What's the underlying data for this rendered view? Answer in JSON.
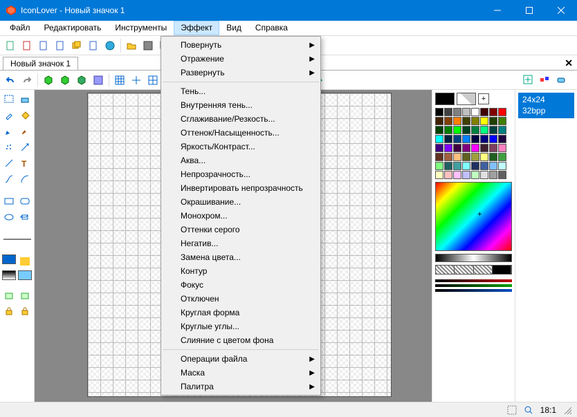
{
  "window": {
    "title": "IconLover - Новый значок 1"
  },
  "menubar": {
    "file": "Файл",
    "edit": "Редактировать",
    "tools": "Инструменты",
    "effect": "Эффект",
    "view": "Вид",
    "help": "Справка"
  },
  "tab": {
    "name": "Новый значок 1"
  },
  "dropdown": {
    "rotate": "Повернуть",
    "flip": "Отражение",
    "unfold": "Развернуть",
    "shadow": "Тень...",
    "inner_shadow": "Внутренняя тень...",
    "smooth": "Сглаживание/Резкость...",
    "hue": "Оттенок/Насыщенность...",
    "brightness": "Яркость/Контраст...",
    "aqua": "Аква...",
    "opacity": "Непрозрачность...",
    "invert_opacity": "Инвертировать непрозрачность",
    "colorize": "Окрашивание...",
    "mono": "Монохром...",
    "grayscale": "Оттенки серого",
    "negative": "Негатив...",
    "replace_color": "Замена цвета...",
    "outline": "Контур",
    "focus": "Фокус",
    "disabled": "Отключен",
    "round_shape": "Круглая форма",
    "round_corners": "Круглые углы...",
    "merge_bg": "Слияние с цветом фона",
    "file_ops": "Операции файла",
    "mask": "Маска",
    "palette": "Палитра"
  },
  "sizes": {
    "dim": "24x24",
    "bpp": "32bpp"
  },
  "status": {
    "zoom": "18:1"
  },
  "palette_colors": [
    "#000000",
    "#404040",
    "#808080",
    "#c0c0c0",
    "#ffffff",
    "#400000",
    "#800000",
    "#ff0000",
    "#402000",
    "#804000",
    "#ff8000",
    "#404000",
    "#808000",
    "#ffff00",
    "#204000",
    "#408000",
    "#004000",
    "#008000",
    "#00ff00",
    "#004020",
    "#008040",
    "#00ff80",
    "#004040",
    "#008080",
    "#00ffff",
    "#002040",
    "#004080",
    "#0080ff",
    "#000040",
    "#000080",
    "#0000ff",
    "#200040",
    "#400080",
    "#8000ff",
    "#400040",
    "#800080",
    "#ff00ff",
    "#402030",
    "#804060",
    "#ff80c0",
    "#603020",
    "#a06040",
    "#ffc080",
    "#606020",
    "#a0a040",
    "#ffff80",
    "#206020",
    "#40a040",
    "#80ff80",
    "#206060",
    "#40a0a0",
    "#80ffff",
    "#203060",
    "#4060a0",
    "#80c0ff",
    "#c0ffff",
    "#ffffc0",
    "#ffc0c0",
    "#ffc0ff",
    "#c0c0ff",
    "#c0ffc0",
    "#e0e0e0",
    "#a0a0a0",
    "#606060"
  ],
  "alpha_lines": [
    "#c00000",
    "#00a000",
    "#0050c0"
  ]
}
